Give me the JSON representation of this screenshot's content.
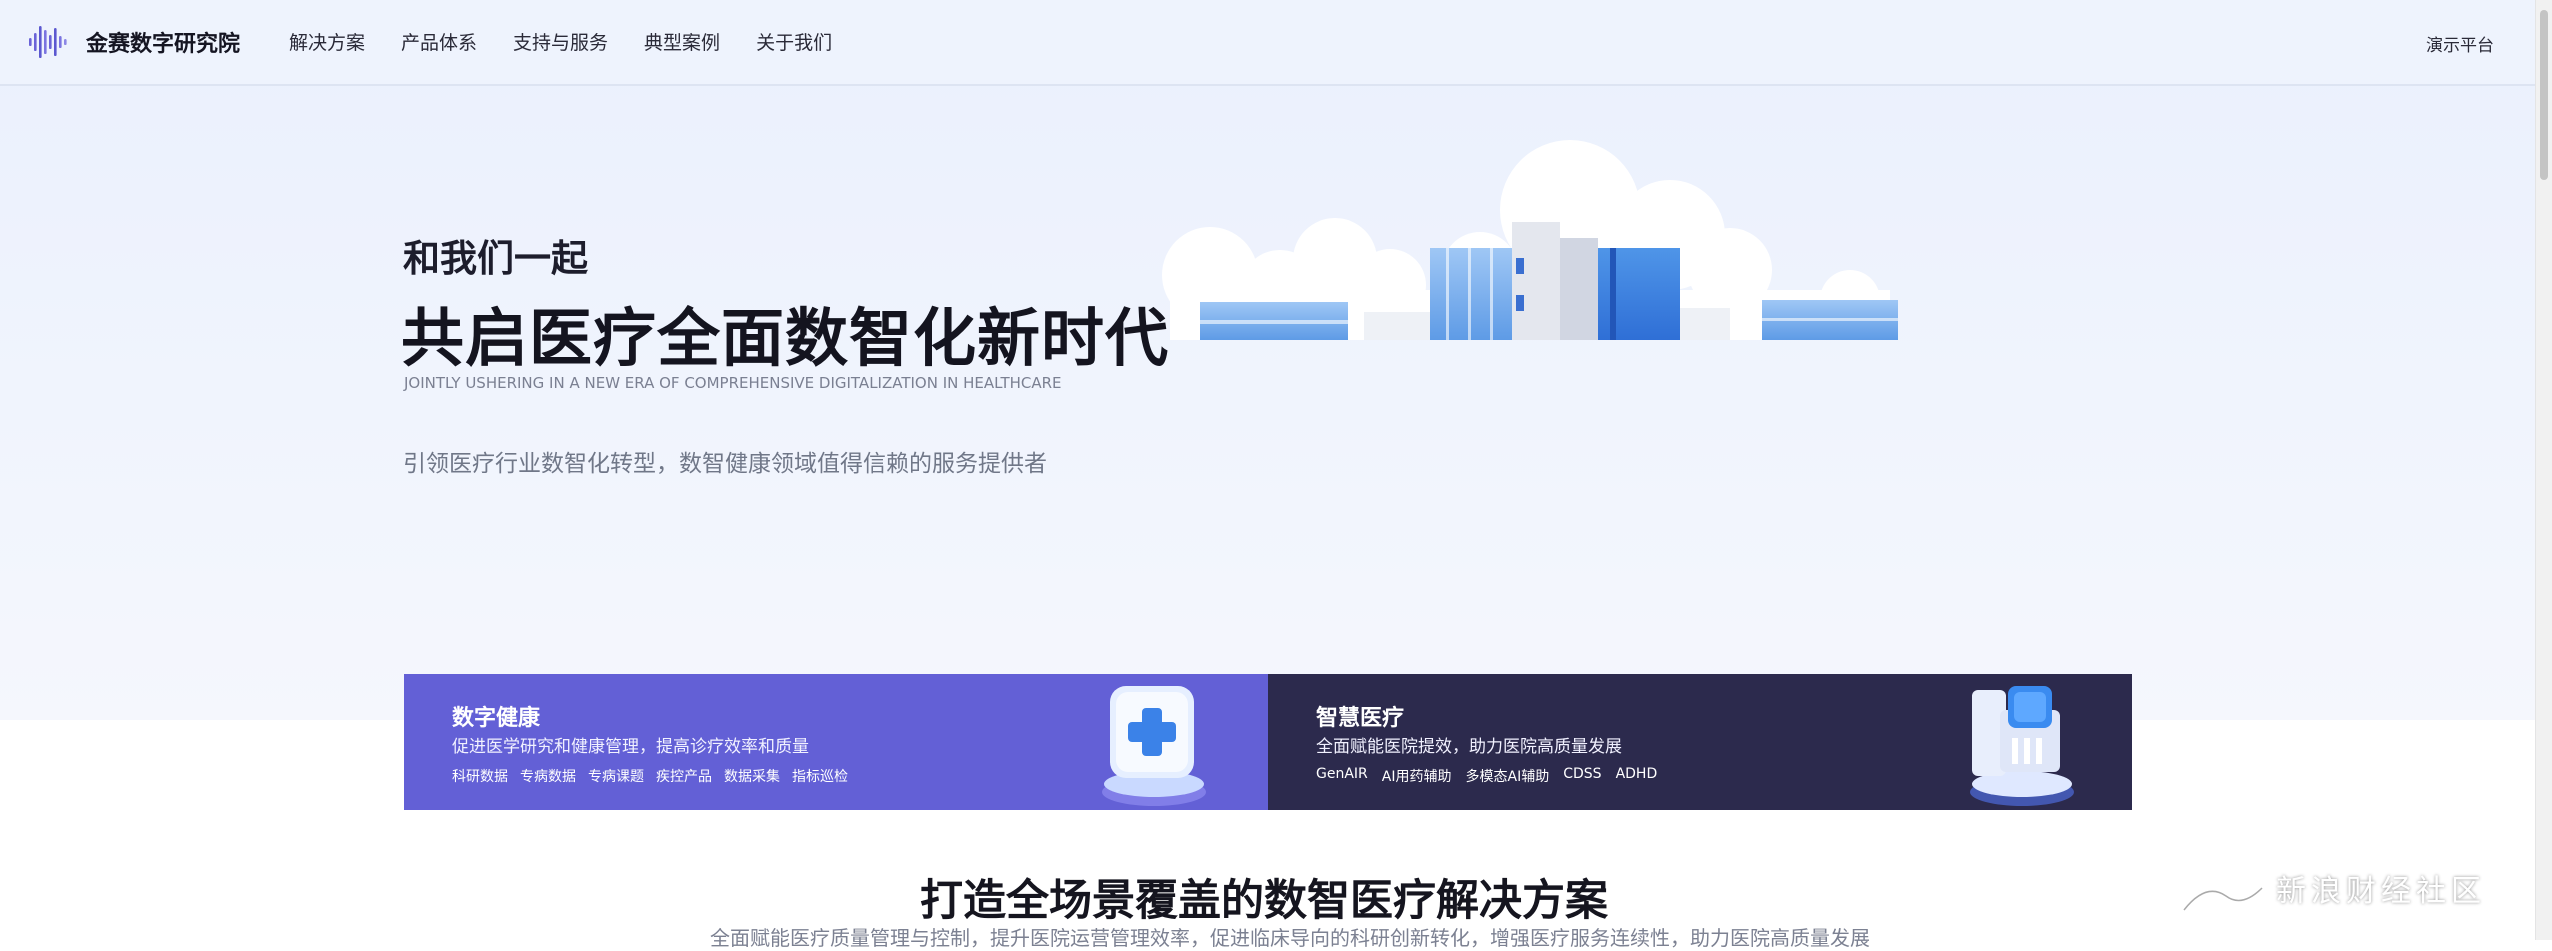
{
  "nav": {
    "brand": "金赛数字研究院",
    "items": [
      {
        "label": "解决方案"
      },
      {
        "label": "产品体系"
      },
      {
        "label": "支持与服务"
      },
      {
        "label": "典型案例"
      },
      {
        "label": "关于我们"
      }
    ],
    "demo_label": "演示平台"
  },
  "hero": {
    "kicker": "和我们一起",
    "title": "共启医疗全面数智化新时代",
    "english": "JOINTLY USHERING IN A NEW ERA OF COMPREHENSIVE DIGITALIZATION IN HEALTHCARE",
    "subtitle": "引领医疗行业数智化转型，数智健康领域值得信赖的服务提供者"
  },
  "cards": [
    {
      "title": "数字健康",
      "desc": "促进医学研究和健康管理，提高诊疗效率和质量",
      "tags": [
        "科研数据",
        "专病数据",
        "专病课题",
        "疾控产品",
        "数据采集",
        "指标巡检"
      ],
      "color": "#6360d6"
    },
    {
      "title": "智慧医疗",
      "desc": "全面赋能医院提效，助力医院高质量发展",
      "tags": [
        "GenAIR",
        "AI用药辅助",
        "多模态AI辅助",
        "CDSS",
        "ADHD"
      ],
      "color": "#2c2a4d"
    }
  ],
  "section": {
    "title": "打造全场景覆盖的数智医疗解决方案",
    "subtitle": "全面赋能医疗质量管理与控制，提升医院运营管理效率，促进临床导向的科研创新转化，增强医疗服务连续性，助力医院高质量发展"
  },
  "watermark": {
    "text": "新浪财经社区"
  },
  "icons": {
    "logo": "soundwave-logo-icon",
    "card_a": "medical-cross-icon",
    "card_b": "ai-chip-stack-icon"
  }
}
